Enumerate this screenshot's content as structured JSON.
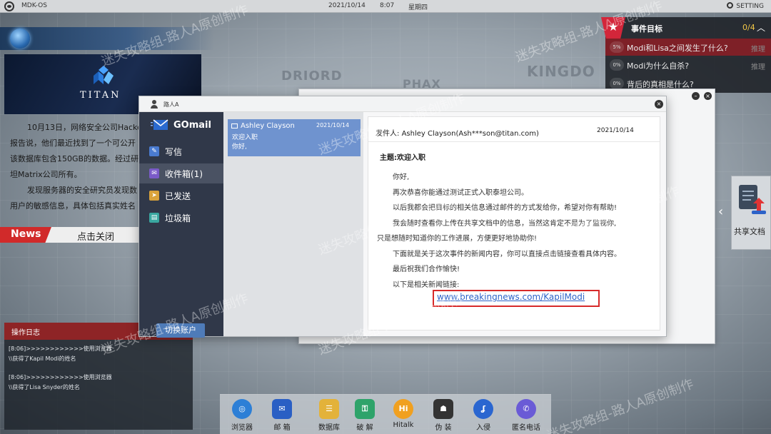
{
  "topbar": {
    "os_name": "MDK-OS",
    "date": "2021/10/14",
    "time": "8:07",
    "weekday": "星期四",
    "setting": "SETTING"
  },
  "map_labels": [
    "DRIORD",
    "PHAX",
    "KINGDO"
  ],
  "titan": {
    "logo_text": "TITAN"
  },
  "article": {
    "lines": [
      "10月13日，网络安全公司Hacke",
      "报告说，他们最近找到了一个可公开",
      "该数据库包含150GB的数据。经过研",
      "坦Matrix公司所有。",
      "发现服务器的安全研究员发现数",
      "用户的敏感信息，具体包括真实姓名"
    ]
  },
  "news": {
    "tag": "News",
    "close": "点击关闭"
  },
  "oplog": {
    "title": "操作日志",
    "entries": [
      "[8:06]>>>>>>>>>>>>使用浏览器",
      "\\\\获得了Kapil Modi的姓名",
      "[8:06]>>>>>>>>>>>>使用浏览器",
      "\\\\获得了Lisa Snyder的姓名"
    ]
  },
  "objectives": {
    "title": "事件目标",
    "count": "0/4",
    "items": [
      {
        "pct": "5%",
        "text": "Modi和Lisa之间发生了什么?",
        "hint": "推理"
      },
      {
        "pct": "0%",
        "text": "Modi为什么自杀?",
        "hint": "推理"
      },
      {
        "pct": "0%",
        "text": "背后的真相是什么?",
        "hint": ""
      }
    ]
  },
  "share": {
    "label": "共享文档"
  },
  "mail": {
    "window_user": "路人A",
    "app_name": "GOmail",
    "folders": [
      {
        "label": "写信",
        "icon": "compose-icon",
        "color": "#4a7bd0"
      },
      {
        "label": "收件箱(1)",
        "icon": "inbox-icon",
        "color": "#7a5bc8"
      },
      {
        "label": "已发送",
        "icon": "send-icon",
        "color": "#d9a23a"
      },
      {
        "label": "垃圾箱",
        "icon": "trash-icon",
        "color": "#3aa7a0"
      }
    ],
    "switch_account": "切换账户",
    "list": [
      {
        "sender": "Ashley Clayson",
        "date": "2021/10/14",
        "subject": "欢迎入职",
        "preview": "你好,"
      }
    ],
    "reader": {
      "from_label": "发件人:",
      "from": "Ashley Clayson(Ash***son@titan.com)",
      "date": "2021/10/14",
      "subject_label": "主题:",
      "subject": "欢迎入职",
      "body": [
        "你好,",
        "再次恭喜你能通过测试正式入职泰坦公司。",
        "以后我都会把目标的相关信息通过邮件的方式发给你，希望对你有帮助!",
        "我会随时查看你上传在共享文档中的信息，当然这肯定不是为了监视你,",
        "只是想随时知道你的工作进展，方便更好地协助你!",
        "下面就是关于这次事件的新闻内容，你可以直接点击链接查看具体内容。",
        "最后祝我们合作愉快!",
        "以下是相关新闻链接:"
      ],
      "link": "www.breakingnews.com/KapilModi"
    }
  },
  "watermark": "迷失攻略组-路人A原创制作",
  "dock": [
    {
      "label": "浏览器",
      "icon": "browser-icon",
      "color": "#2d7fd6"
    },
    {
      "label": "邮 箱",
      "icon": "mail-icon",
      "color": "#2a5fc4"
    },
    {
      "label": "数据库",
      "icon": "database-icon",
      "color": "#e3b23a"
    },
    {
      "label": "破 解",
      "icon": "crack-icon",
      "color": "#2ea36a"
    },
    {
      "label": "Hitalk",
      "icon": "hitalk-icon",
      "color": "#f0a020"
    },
    {
      "label": "伪 装",
      "icon": "disguise-icon",
      "color": "#333333"
    },
    {
      "label": "入侵",
      "icon": "hook-icon",
      "color": "#2a66d0"
    },
    {
      "label": "匿名电话",
      "icon": "phone-icon",
      "color": "#6a5bd6"
    }
  ]
}
